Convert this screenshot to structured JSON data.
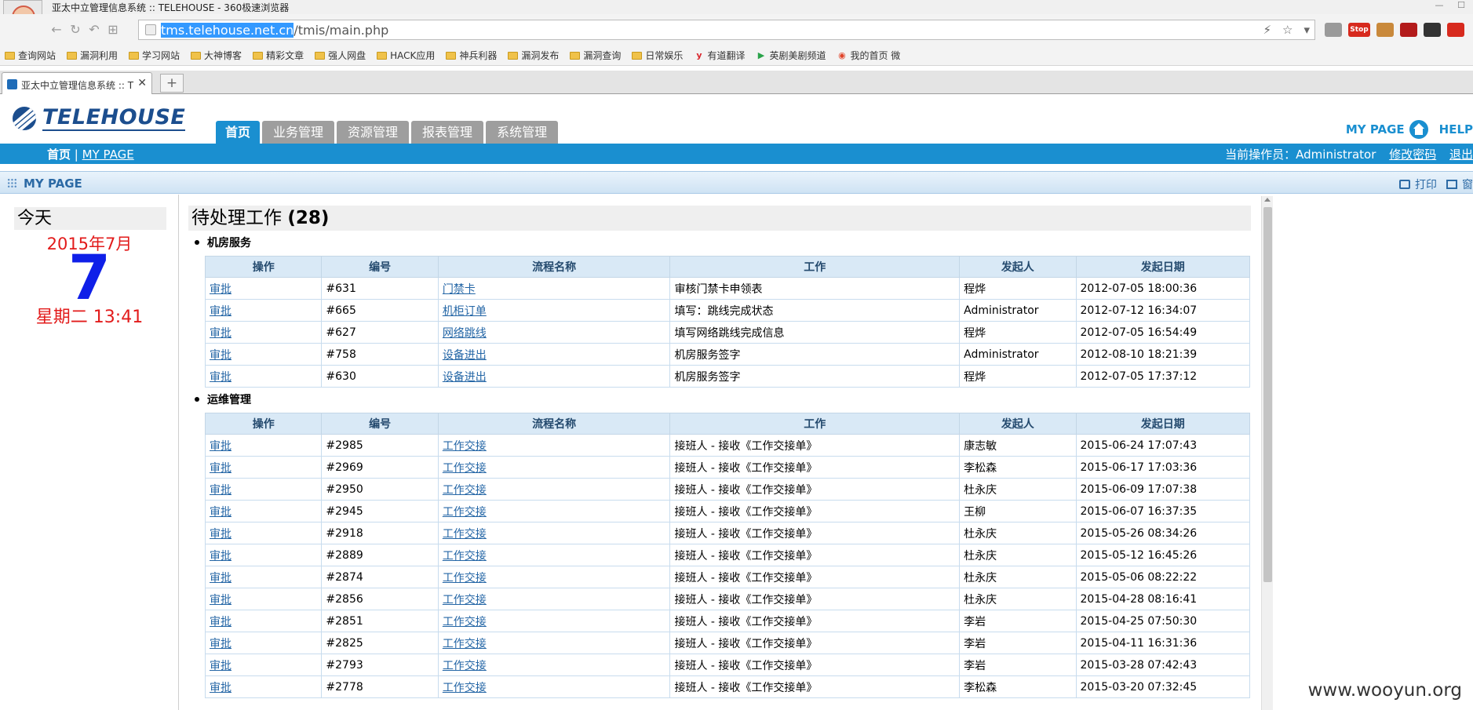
{
  "browser": {
    "window_title": "亚太中立管理信息系统 :: TELEHOUSE - 360极速浏览器",
    "url_host": "tms.telehouse.net.cn",
    "url_path": "/tmis/main.php",
    "tab_title": "亚太中立管理信息系统 :: TE",
    "new_tab_label": "+",
    "bookmarks": [
      {
        "label": "查询网站",
        "icon": "folder-icon"
      },
      {
        "label": "漏洞利用",
        "icon": "folder-icon"
      },
      {
        "label": "学习网站",
        "icon": "folder-icon"
      },
      {
        "label": "大神博客",
        "icon": "folder-icon"
      },
      {
        "label": "精彩文章",
        "icon": "folder-icon"
      },
      {
        "label": "强人网盘",
        "icon": "folder-icon"
      },
      {
        "label": "HACK应用",
        "icon": "folder-icon"
      },
      {
        "label": "神兵利器",
        "icon": "folder-icon"
      },
      {
        "label": "漏洞发布",
        "icon": "folder-icon"
      },
      {
        "label": "漏洞查询",
        "icon": "folder-icon"
      },
      {
        "label": "日常娱乐",
        "icon": "folder-icon"
      },
      {
        "label": "有道翻译",
        "icon": "youdao-icon"
      },
      {
        "label": "英剧美剧频道",
        "icon": "play-icon"
      },
      {
        "label": "我的首页 微",
        "icon": "weibo-icon"
      }
    ],
    "ext_stop_label": "Stop",
    "colors": {
      "chrome": "#f3f3f3",
      "url_highlight": "#3399ff"
    }
  },
  "header": {
    "logo_text": "TELEHOUSE",
    "tabs": [
      "首页",
      "业务管理",
      "资源管理",
      "报表管理",
      "系统管理"
    ],
    "active_tab": "首页",
    "mypage_link": "MY PAGE",
    "help_link": "HELP",
    "brand_color": "#1a8fd0"
  },
  "bluebar": {
    "home": "首页",
    "separator": "|",
    "mypage": "MY PAGE",
    "operator_label": "当前操作员：",
    "operator_name": "Administrator",
    "change_password": "修改密码",
    "logout": "退出"
  },
  "panel": {
    "title": "MY PAGE",
    "print": "打印",
    "window": "窗"
  },
  "calendar": {
    "heading": "今天",
    "month": "2015年7月",
    "day": "7",
    "weekday_time": "星期二 13:41"
  },
  "pending": {
    "title": "待处理工作",
    "count": "(28)",
    "columns": [
      "操作",
      "编号",
      "流程名称",
      "工作",
      "发起人",
      "发起日期"
    ],
    "groups": [
      {
        "name": "机房服务",
        "rows": [
          {
            "action": "审批",
            "id": "#631",
            "process": "门禁卡",
            "work": "审核门禁卡申领表",
            "initiator": "程烨",
            "date": "2012-07-05 18:00:36"
          },
          {
            "action": "审批",
            "id": "#665",
            "process": "机柜订单",
            "work": "填写：跳线完成状态",
            "initiator": "Administrator",
            "date": "2012-07-12 16:34:07"
          },
          {
            "action": "审批",
            "id": "#627",
            "process": "网络跳线",
            "work": "填写网络跳线完成信息",
            "initiator": "程烨",
            "date": "2012-07-05 16:54:49"
          },
          {
            "action": "审批",
            "id": "#758",
            "process": "设备进出",
            "work": "机房服务签字",
            "initiator": "Administrator",
            "date": "2012-08-10 18:21:39"
          },
          {
            "action": "审批",
            "id": "#630",
            "process": "设备进出",
            "work": "机房服务签字",
            "initiator": "程烨",
            "date": "2012-07-05 17:37:12"
          }
        ]
      },
      {
        "name": "运维管理",
        "rows": [
          {
            "action": "审批",
            "id": "#2985",
            "process": "工作交接",
            "work": "接班人 - 接收《工作交接单》",
            "initiator": "康志敏",
            "date": "2015-06-24 17:07:43"
          },
          {
            "action": "审批",
            "id": "#2969",
            "process": "工作交接",
            "work": "接班人 - 接收《工作交接单》",
            "initiator": "李松森",
            "date": "2015-06-17 17:03:36"
          },
          {
            "action": "审批",
            "id": "#2950",
            "process": "工作交接",
            "work": "接班人 - 接收《工作交接单》",
            "initiator": "杜永庆",
            "date": "2015-06-09 17:07:38"
          },
          {
            "action": "审批",
            "id": "#2945",
            "process": "工作交接",
            "work": "接班人 - 接收《工作交接单》",
            "initiator": "王柳",
            "date": "2015-06-07 16:37:35"
          },
          {
            "action": "审批",
            "id": "#2918",
            "process": "工作交接",
            "work": "接班人 - 接收《工作交接单》",
            "initiator": "杜永庆",
            "date": "2015-05-26 08:34:26"
          },
          {
            "action": "审批",
            "id": "#2889",
            "process": "工作交接",
            "work": "接班人 - 接收《工作交接单》",
            "initiator": "杜永庆",
            "date": "2015-05-12 16:45:26"
          },
          {
            "action": "审批",
            "id": "#2874",
            "process": "工作交接",
            "work": "接班人 - 接收《工作交接单》",
            "initiator": "杜永庆",
            "date": "2015-05-06 08:22:22"
          },
          {
            "action": "审批",
            "id": "#2856",
            "process": "工作交接",
            "work": "接班人 - 接收《工作交接单》",
            "initiator": "杜永庆",
            "date": "2015-04-28 08:16:41"
          },
          {
            "action": "审批",
            "id": "#2851",
            "process": "工作交接",
            "work": "接班人 - 接收《工作交接单》",
            "initiator": "李岩",
            "date": "2015-04-25 07:50:30"
          },
          {
            "action": "审批",
            "id": "#2825",
            "process": "工作交接",
            "work": "接班人 - 接收《工作交接单》",
            "initiator": "李岩",
            "date": "2015-04-11 16:31:36"
          },
          {
            "action": "审批",
            "id": "#2793",
            "process": "工作交接",
            "work": "接班人 - 接收《工作交接单》",
            "initiator": "李岩",
            "date": "2015-03-28 07:42:43"
          },
          {
            "action": "审批",
            "id": "#2778",
            "process": "工作交接",
            "work": "接班人 - 接收《工作交接单》",
            "initiator": "李松森",
            "date": "2015-03-20 07:32:45"
          }
        ]
      }
    ]
  },
  "watermark": "www.wooyun.org"
}
